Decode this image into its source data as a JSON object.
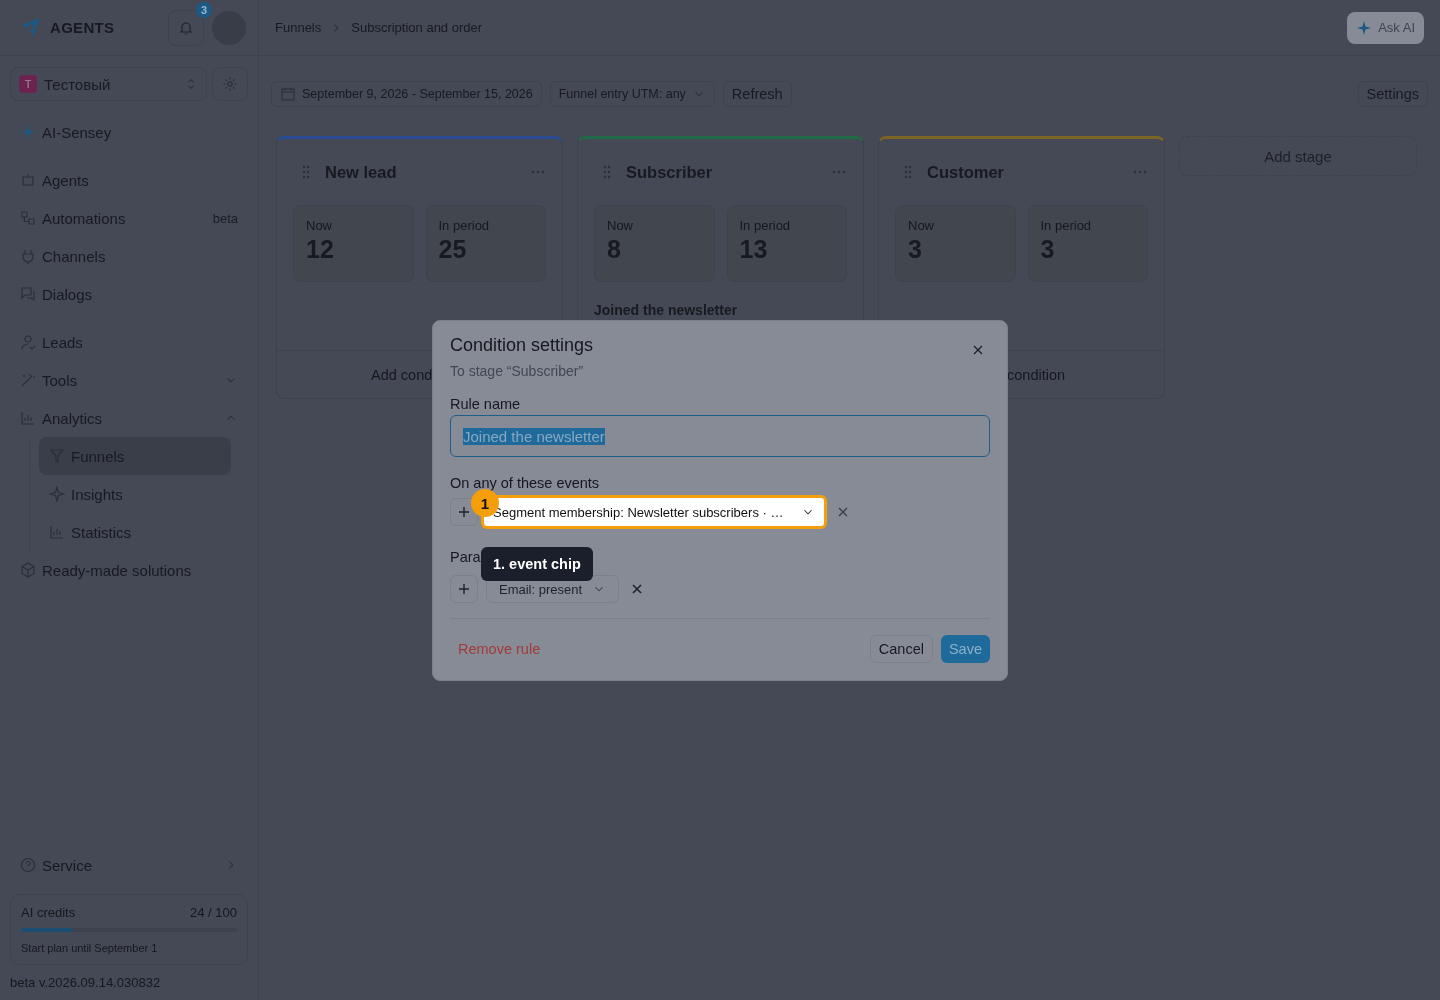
{
  "brand": {
    "name": "AGENTS"
  },
  "notifications": {
    "count": "3"
  },
  "workspace": {
    "initial": "Т",
    "name": "Тестовый"
  },
  "sidebar": {
    "groups": [
      [
        {
          "label": "AI-Sensey"
        }
      ],
      [
        {
          "label": "Agents"
        },
        {
          "label": "Automations",
          "badge": "beta"
        },
        {
          "label": "Channels"
        },
        {
          "label": "Dialogs"
        }
      ],
      [
        {
          "label": "Leads"
        },
        {
          "label": "Tools",
          "expanded": false
        },
        {
          "label": "Analytics",
          "expanded": true,
          "children": [
            {
              "label": "Funnels",
              "selected": true
            },
            {
              "label": "Insights",
              "selected": false
            },
            {
              "label": "Statistics",
              "selected": false
            }
          ]
        },
        {
          "label": "Ready-made solutions"
        }
      ]
    ],
    "service": {
      "label": "Service"
    },
    "credits": {
      "label": "AI credits",
      "reading": "24 / 100",
      "level": 0.24,
      "note": "Start plan until September 1"
    },
    "version": "beta v.2026.09.14.030832"
  },
  "header": {
    "breadcrumb": [
      "Funnels",
      "Subscription and order"
    ],
    "ask_ai": "Ask AI"
  },
  "toolbar": {
    "date_range": "September 9, 2026 - September 15, 2026",
    "utm_filter": "Funnel entry UTM: any",
    "refresh": "Refresh",
    "settings": "Settings"
  },
  "stages": [
    {
      "name": "New lead",
      "color": "#2a4c92",
      "now_label": "Now",
      "now": "12",
      "period_label": "In period",
      "period": "25",
      "footer": "Add cond"
    },
    {
      "name": "Subscriber",
      "color": "#1f6b45",
      "now_label": "Now",
      "now": "8",
      "period_label": "In period",
      "period": "13",
      "rule": "Joined the newsletter"
    },
    {
      "name": "Customer",
      "color": "#7c6424",
      "now_label": "Now",
      "now": "3",
      "period_label": "In period",
      "period": "3",
      "footer": "condition"
    }
  ],
  "add_stage": "Add stage",
  "dialog": {
    "title": "Condition settings",
    "subtitle": "To stage “Subscriber”",
    "rule_name_label": "Rule name",
    "rule_name": "Joined the newsletter",
    "rule_name_selected": true,
    "events_label": "On any of these events",
    "events": [
      {
        "label": "Segment membership: Newsletter subscribers · …",
        "highlighted": true
      }
    ],
    "params_label": "Para",
    "params": [
      {
        "label": "Email: present"
      }
    ],
    "remove": "Remove rule",
    "cancel": "Cancel",
    "save": "Save"
  },
  "annotation": {
    "number": "1",
    "label": "1. event chip"
  }
}
